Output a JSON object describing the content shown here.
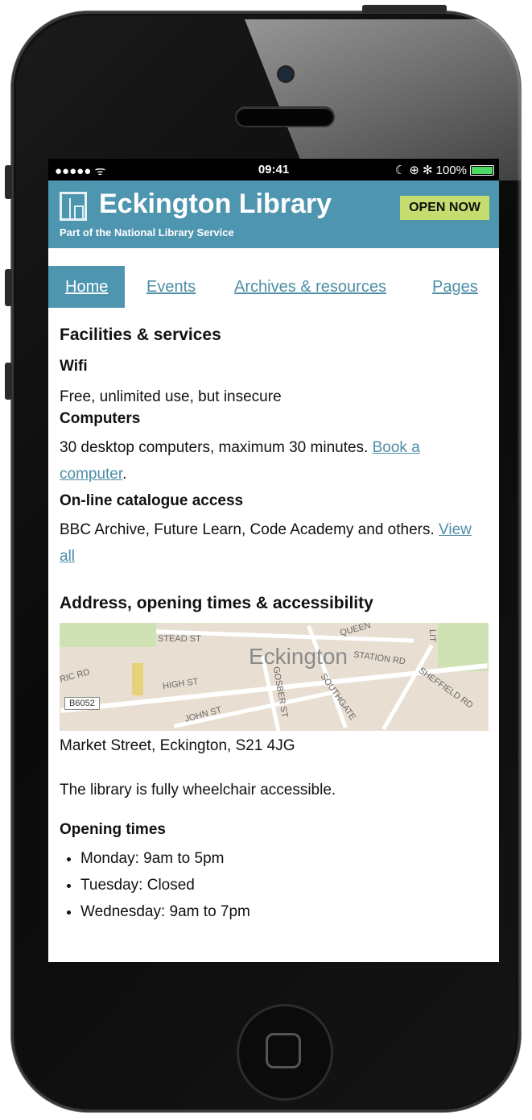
{
  "status_bar": {
    "signal": "●●●●● ᯤ",
    "time": "09:41",
    "icons": "☾ ⊕ ✻",
    "battery": "100%",
    "battery_color": "#4cd964"
  },
  "header": {
    "title": "Eckington Library",
    "subtitle": "Part of the National Library Service",
    "badge": "OPEN NOW",
    "bg_color": "#4e95b0",
    "badge_color": "#c5dc6e"
  },
  "nav": {
    "items": [
      {
        "label": "Home",
        "active": true
      },
      {
        "label": "Events",
        "active": false
      },
      {
        "label": "Archives & resources",
        "active": false
      },
      {
        "label": "Pages",
        "active": false
      }
    ]
  },
  "facilities": {
    "heading": "Facilities & services",
    "wifi_title": "Wifi",
    "wifi_text": "Free, unlimited use, but insecure",
    "computers_title": "Computers",
    "computers_text": "30 desktop computers, maximum 30 minutes. ",
    "computers_link": "Book a computer",
    "catalogue_title": "On-line catalogue access",
    "catalogue_text": "BBC Archive, Future Learn, Code Academy and others. ",
    "catalogue_link": "View all"
  },
  "address": {
    "heading": "Address, opening times & accessibility",
    "map_labels": {
      "town": "Eckington",
      "stead": "STEAD ST",
      "queen": "QUEEN",
      "station": "STATION RD",
      "high": "HIGH ST",
      "ric": "RIC RD",
      "b6052": "B6052",
      "john": "JOHN ST",
      "gosber": "GOSBER ST",
      "southgate": "SOUTHGATE",
      "sheffield": "SHEFFIELD RD",
      "lit": "LIT"
    },
    "street": "Market Street, Eckington, S21 4JG",
    "accessibility": "The library is fully wheelchair accessible.",
    "opening_heading": "Opening times",
    "times": [
      "Monday: 9am to 5pm",
      "Tuesday: Closed",
      "Wednesday: 9am to 7pm"
    ]
  }
}
